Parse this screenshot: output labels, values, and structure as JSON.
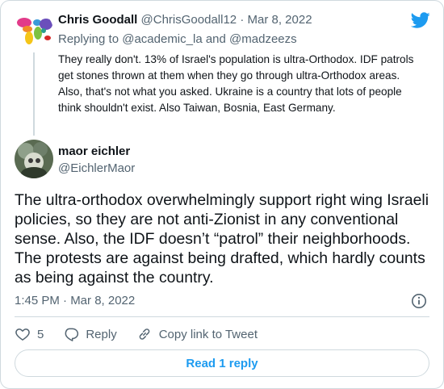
{
  "quoted_tweet": {
    "author_name": "Chris Goodall",
    "author_handle": "@ChrisGoodall12",
    "separator": "·",
    "date": "Mar 8, 2022",
    "replying_prefix": "Replying to",
    "reply_to_1": "@academic_la",
    "reply_conjunction": "and",
    "reply_to_2": "@madzeezs",
    "text": "They really don't. 13% of Israel's population is ultra-Orthodox. IDF patrols get stones thrown at them when they go through ultra-Orthodox areas. Also, that's not what you asked. Ukraine is a country that lots of people think shouldn't exist. Also Taiwan, Bosnia, East Germany."
  },
  "main_tweet": {
    "author_name": "maor eichler",
    "author_handle": "@EichlerMaor",
    "text": "The ultra-orthodox overwhelmingly support right wing Israeli policies, so they are not anti-Zionist in any conventional sense. Also, the IDF doesn’t “patrol” their neighborhoods. The protests are against being drafted, which hardly counts as being against the country.",
    "timestamp": "1:45 PM · Mar 8, 2022"
  },
  "actions": {
    "like_count": "5",
    "reply_label": "Reply",
    "copy_label": "Copy link to Tweet"
  },
  "read_reply_label": "Read 1 reply",
  "colors": {
    "brand": "#1d9bf0",
    "muted": "#536471",
    "border": "#cfd9de"
  }
}
